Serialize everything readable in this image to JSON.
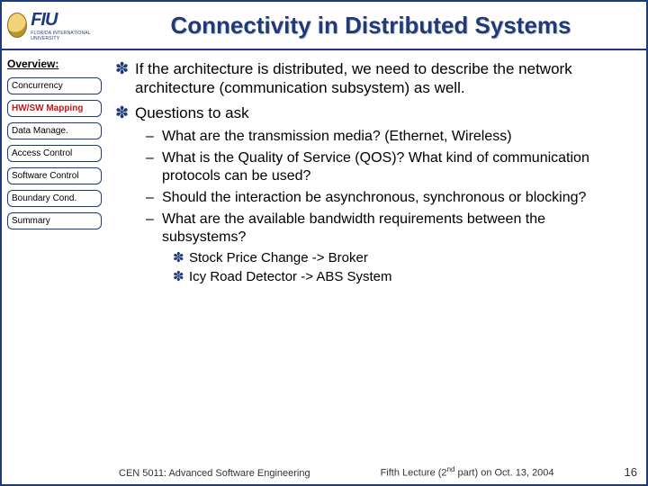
{
  "header": {
    "logo_text": "FIU",
    "logo_sub": "FLORIDA INTERNATIONAL UNIVERSITY",
    "title": "Connectivity in Distributed Systems"
  },
  "sidebar": {
    "heading": "Overview:",
    "items": [
      {
        "label": "Concurrency",
        "active": false
      },
      {
        "label": "HW/SW Mapping",
        "active": true
      },
      {
        "label": "Data Manage.",
        "active": false
      },
      {
        "label": "Access Control",
        "active": false
      },
      {
        "label": "Software Control",
        "active": false
      },
      {
        "label": "Boundary Cond.",
        "active": false
      },
      {
        "label": "Summary",
        "active": false
      }
    ]
  },
  "content": {
    "bullets": [
      "If the architecture is distributed, we need to describe the network architecture (communication subsystem) as well.",
      "Questions to ask"
    ],
    "sub_bullets": [
      "What are the transmission media? (Ethernet, Wireless)",
      "What is the Quality of Service (QOS)? What kind of communication protocols can be used?",
      "Should the interaction be asynchronous, synchronous or blocking?",
      "What are the available bandwidth requirements between the subsystems?"
    ],
    "sub_sub": [
      "Stock Price Change  -> Broker",
      "Icy Road Detector  -> ABS System"
    ]
  },
  "footer": {
    "course": "CEN 5011: Advanced Software Engineering",
    "lecture_a": "Fifth Lecture (2",
    "lecture_b": " part) on Oct. 13, 2004",
    "ord": "nd",
    "page": "16"
  }
}
